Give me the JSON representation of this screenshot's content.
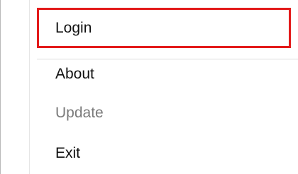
{
  "menu": {
    "items": [
      {
        "label": "Login",
        "state": "enabled",
        "highlighted": true
      },
      {
        "label": "About",
        "state": "enabled"
      },
      {
        "label": "Update",
        "state": "disabled"
      },
      {
        "label": "Exit",
        "state": "enabled"
      }
    ]
  },
  "colors": {
    "highlight_border": "#e31b1b",
    "disabled_text": "#7a7a7a",
    "enabled_text": "#111111"
  }
}
